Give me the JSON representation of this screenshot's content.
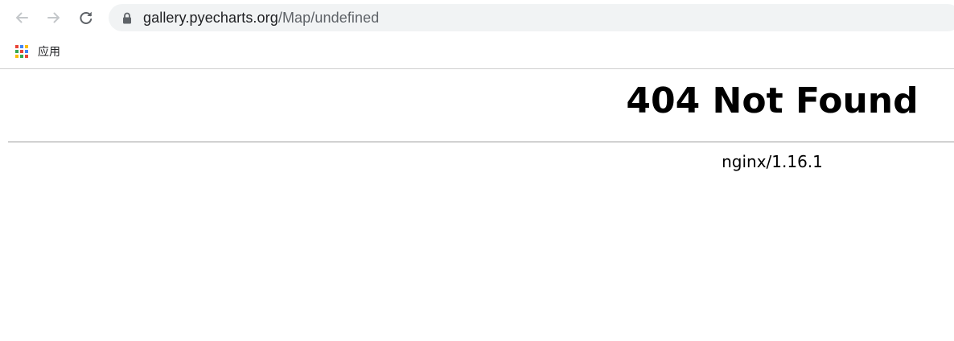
{
  "browser": {
    "url_host": "gallery.pyecharts.org",
    "url_path": "/Map/undefined",
    "icons": {
      "back": "arrow-left-icon",
      "forward": "arrow-right-icon",
      "reload": "reload-icon",
      "secure": "lock-icon",
      "apps": "apps-grid-icon"
    }
  },
  "bookmarks": {
    "apps_label": "应用"
  },
  "page": {
    "title": "404 Not Found",
    "server": "nginx/1.16.1"
  },
  "colors": {
    "omnibox_bg": "#f1f3f4",
    "rule": "#9b9b9b",
    "nav_disabled": "#bdc1c6",
    "nav_enabled": "#5f6368"
  }
}
